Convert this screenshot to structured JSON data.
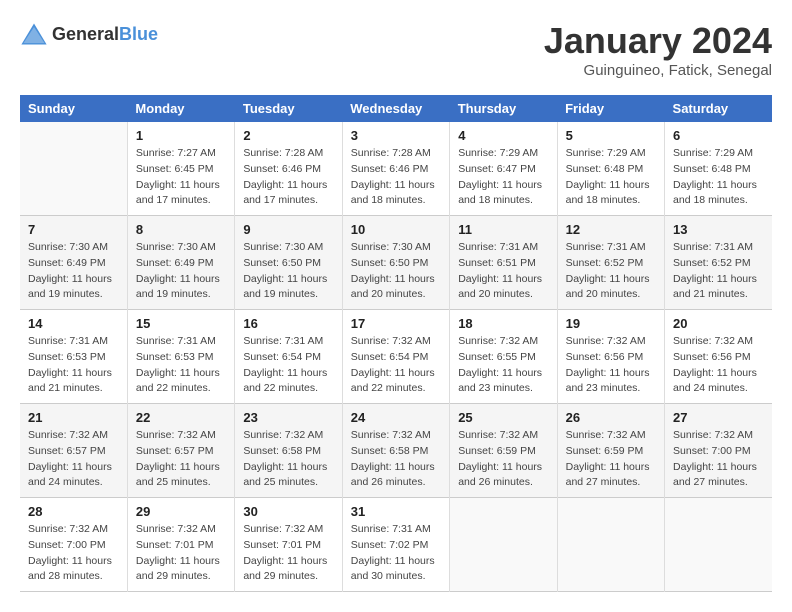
{
  "header": {
    "logo_general": "General",
    "logo_blue": "Blue",
    "month_title": "January 2024",
    "location": "Guinguineo, Fatick, Senegal"
  },
  "days_of_week": [
    "Sunday",
    "Monday",
    "Tuesday",
    "Wednesday",
    "Thursday",
    "Friday",
    "Saturday"
  ],
  "weeks": [
    [
      {
        "day": "",
        "info": ""
      },
      {
        "day": "1",
        "info": "Sunrise: 7:27 AM\nSunset: 6:45 PM\nDaylight: 11 hours\nand 17 minutes."
      },
      {
        "day": "2",
        "info": "Sunrise: 7:28 AM\nSunset: 6:46 PM\nDaylight: 11 hours\nand 17 minutes."
      },
      {
        "day": "3",
        "info": "Sunrise: 7:28 AM\nSunset: 6:46 PM\nDaylight: 11 hours\nand 18 minutes."
      },
      {
        "day": "4",
        "info": "Sunrise: 7:29 AM\nSunset: 6:47 PM\nDaylight: 11 hours\nand 18 minutes."
      },
      {
        "day": "5",
        "info": "Sunrise: 7:29 AM\nSunset: 6:48 PM\nDaylight: 11 hours\nand 18 minutes."
      },
      {
        "day": "6",
        "info": "Sunrise: 7:29 AM\nSunset: 6:48 PM\nDaylight: 11 hours\nand 18 minutes."
      }
    ],
    [
      {
        "day": "7",
        "info": "Sunrise: 7:30 AM\nSunset: 6:49 PM\nDaylight: 11 hours\nand 19 minutes."
      },
      {
        "day": "8",
        "info": "Sunrise: 7:30 AM\nSunset: 6:49 PM\nDaylight: 11 hours\nand 19 minutes."
      },
      {
        "day": "9",
        "info": "Sunrise: 7:30 AM\nSunset: 6:50 PM\nDaylight: 11 hours\nand 19 minutes."
      },
      {
        "day": "10",
        "info": "Sunrise: 7:30 AM\nSunset: 6:50 PM\nDaylight: 11 hours\nand 20 minutes."
      },
      {
        "day": "11",
        "info": "Sunrise: 7:31 AM\nSunset: 6:51 PM\nDaylight: 11 hours\nand 20 minutes."
      },
      {
        "day": "12",
        "info": "Sunrise: 7:31 AM\nSunset: 6:52 PM\nDaylight: 11 hours\nand 20 minutes."
      },
      {
        "day": "13",
        "info": "Sunrise: 7:31 AM\nSunset: 6:52 PM\nDaylight: 11 hours\nand 21 minutes."
      }
    ],
    [
      {
        "day": "14",
        "info": "Sunrise: 7:31 AM\nSunset: 6:53 PM\nDaylight: 11 hours\nand 21 minutes."
      },
      {
        "day": "15",
        "info": "Sunrise: 7:31 AM\nSunset: 6:53 PM\nDaylight: 11 hours\nand 22 minutes."
      },
      {
        "day": "16",
        "info": "Sunrise: 7:31 AM\nSunset: 6:54 PM\nDaylight: 11 hours\nand 22 minutes."
      },
      {
        "day": "17",
        "info": "Sunrise: 7:32 AM\nSunset: 6:54 PM\nDaylight: 11 hours\nand 22 minutes."
      },
      {
        "day": "18",
        "info": "Sunrise: 7:32 AM\nSunset: 6:55 PM\nDaylight: 11 hours\nand 23 minutes."
      },
      {
        "day": "19",
        "info": "Sunrise: 7:32 AM\nSunset: 6:56 PM\nDaylight: 11 hours\nand 23 minutes."
      },
      {
        "day": "20",
        "info": "Sunrise: 7:32 AM\nSunset: 6:56 PM\nDaylight: 11 hours\nand 24 minutes."
      }
    ],
    [
      {
        "day": "21",
        "info": "Sunrise: 7:32 AM\nSunset: 6:57 PM\nDaylight: 11 hours\nand 24 minutes."
      },
      {
        "day": "22",
        "info": "Sunrise: 7:32 AM\nSunset: 6:57 PM\nDaylight: 11 hours\nand 25 minutes."
      },
      {
        "day": "23",
        "info": "Sunrise: 7:32 AM\nSunset: 6:58 PM\nDaylight: 11 hours\nand 25 minutes."
      },
      {
        "day": "24",
        "info": "Sunrise: 7:32 AM\nSunset: 6:58 PM\nDaylight: 11 hours\nand 26 minutes."
      },
      {
        "day": "25",
        "info": "Sunrise: 7:32 AM\nSunset: 6:59 PM\nDaylight: 11 hours\nand 26 minutes."
      },
      {
        "day": "26",
        "info": "Sunrise: 7:32 AM\nSunset: 6:59 PM\nDaylight: 11 hours\nand 27 minutes."
      },
      {
        "day": "27",
        "info": "Sunrise: 7:32 AM\nSunset: 7:00 PM\nDaylight: 11 hours\nand 27 minutes."
      }
    ],
    [
      {
        "day": "28",
        "info": "Sunrise: 7:32 AM\nSunset: 7:00 PM\nDaylight: 11 hours\nand 28 minutes."
      },
      {
        "day": "29",
        "info": "Sunrise: 7:32 AM\nSunset: 7:01 PM\nDaylight: 11 hours\nand 29 minutes."
      },
      {
        "day": "30",
        "info": "Sunrise: 7:32 AM\nSunset: 7:01 PM\nDaylight: 11 hours\nand 29 minutes."
      },
      {
        "day": "31",
        "info": "Sunrise: 7:31 AM\nSunset: 7:02 PM\nDaylight: 11 hours\nand 30 minutes."
      },
      {
        "day": "",
        "info": ""
      },
      {
        "day": "",
        "info": ""
      },
      {
        "day": "",
        "info": ""
      }
    ]
  ]
}
